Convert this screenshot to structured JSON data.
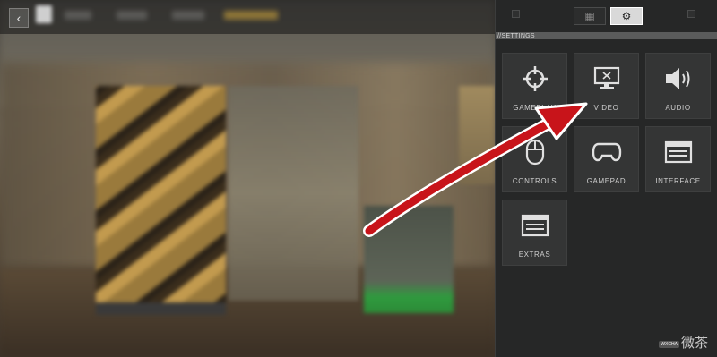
{
  "background": {
    "back_glyph": "‹"
  },
  "panel": {
    "section_label": "//SETTINGS",
    "tabs": [
      {
        "icon": "grid-icon",
        "glyph": "▦",
        "active": false
      },
      {
        "icon": "gear-icon",
        "glyph": "⚙",
        "active": true
      }
    ]
  },
  "tiles": [
    {
      "label": "GAMEPLAY",
      "icon": "crosshair-icon"
    },
    {
      "label": "VIDEO",
      "icon": "monitor-icon"
    },
    {
      "label": "AUDIO",
      "icon": "speaker-icon"
    },
    {
      "label": "CONTROLS",
      "icon": "mouse-icon"
    },
    {
      "label": "GAMEPAD",
      "icon": "gamepad-icon"
    },
    {
      "label": "INTERFACE",
      "icon": "interface-icon"
    },
    {
      "label": "EXTRAS",
      "icon": "extras-icon"
    }
  ],
  "watermark": {
    "text": "微茶",
    "sub": "WXCHA"
  },
  "colors": {
    "annotation_arrow": "#c8141a",
    "active_tab": "#d9d9d9",
    "panel_bg": "#262727",
    "tile_bg": "#343535"
  }
}
